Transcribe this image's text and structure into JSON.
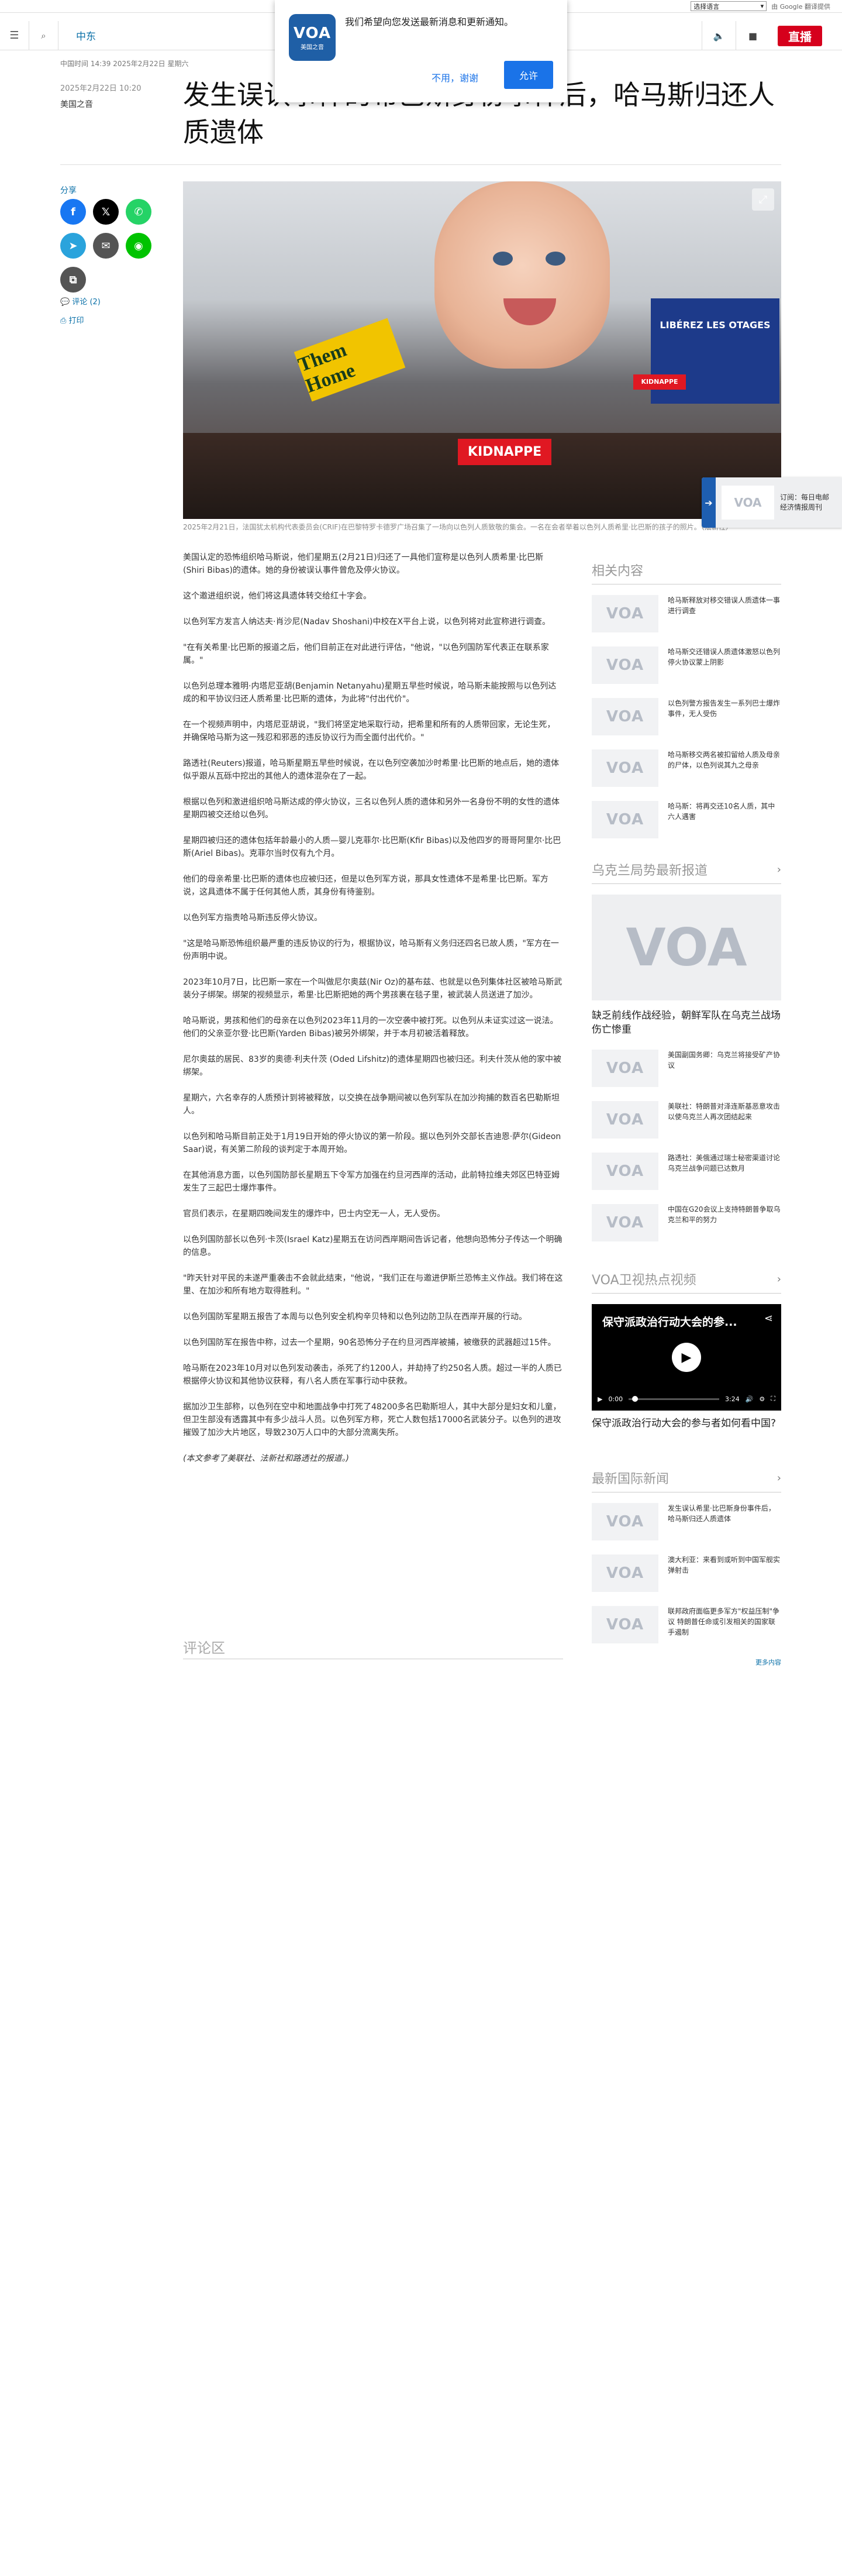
{
  "translate": {
    "select_label": "选择语言",
    "powered": "由 Google",
    "translate": "翻译提供"
  },
  "header": {
    "section": "中东",
    "live": "直播"
  },
  "notify": {
    "logo_main": "VOA",
    "logo_sub": "美国之音",
    "message": "我们希望向您发送最新消息和更新通知。",
    "decline": "不用，谢谢",
    "accept": "允许"
  },
  "article": {
    "dateline": "中国时间 14:39 2025年2月22日 星期六",
    "pubdate": "2025年2月22日 10:20",
    "byline": "美国之音",
    "headline": "发生误认事件的希巴斯身份事件后，哈马斯归还人质遗体",
    "caption": "2025年2月21日，法国犹太机构代表委员会(CRIF)在巴黎特罗卡德罗广场召集了一场向以色列人质致敬的集会。一名在会者举着以色列人质希里·比巴斯的孩子的照片。（法新社）",
    "paragraphs": [
      "美国认定的恐怖组织哈马斯说，他们星期五(2月21日)归还了一具他们宣称是以色列人质希里·比巴斯(Shiri Bibas)的遗体。她的身份被误认事件曾危及停火协议。",
      "这个邀进组织说，他们将这具遗体转交给红十字会。",
      "以色列军方发言人纳达夫·肖沙尼(Nadav Shoshani)中校在X平台上说，以色列将对此宣称进行调查。",
      "\"在有关希里·比巴斯的报道之后，他们目前正在对此进行评估，\"他说，\"以色列国防军代表正在联系家属。\"",
      "以色列总理本雅明·内塔尼亚胡(Benjamin Netanyahu)星期五早些时候说，哈马斯未能按照与以色列达成的和平协议归还人质希里·比巴斯的遗体，为此将\"付出代价\"。",
      "在一个视频声明中，内塔尼亚胡说，\"我们将坚定地采取行动，把希里和所有的人质带回家，无论生死，并确保哈马斯为这一残忍和邪恶的违反协议行为而全面付出代价。\"",
      "路透社(Reuters)报道，哈马斯星期五早些时候说，在以色列空袭加沙时希里·比巴斯的地点后，她的遗体似乎跟从瓦砾中挖出的其他人的遗体混杂在了一起。",
      "根据以色列和激进组织哈马斯达成的停火协议，三名以色列人质的遗体和另外一名身份不明的女性的遗体星期四被交还给以色列。",
      "星期四被归还的遗体包括年龄最小的人质—婴儿克菲尔·比巴斯(Kfir Bibas)以及他四岁的哥哥阿里尔·比巴斯(Ariel Bibas)。克菲尔当时仅有九个月。",
      "他们的母亲希里·比巴斯的遗体也应被归还，但是以色列军方说，那具女性遗体不是希里·比巴斯。军方说，这具遗体不属于任何其他人质，其身份有待鉴别。",
      "以色列军方指责哈马斯违反停火协议。",
      "\"这是哈马斯恐怖组织最严重的违反协议的行为，根据协议，哈马斯有义务归还四名已故人质，\"军方在一份声明中说。",
      "2023年10月7日，比巴斯一家在一个叫做尼尔奥兹(Nir Oz)的基布兹、也就是以色列集体社区被哈马斯武装分子绑架。绑架的视频显示，希里·比巴斯把她的两个男孩裹在毯子里，被武装人员送进了加沙。",
      "哈马斯说，男孩和他们的母亲在以色列2023年11月的一次空袭中被打死。以色列从未证实过这一说法。他们的父亲亚尔登·比巴斯(Yarden Bibas)被另外绑架，并于本月初被活着释放。",
      "尼尔奥兹的居民、83岁的奥德·利夫什茨 (Oded Lifshitz)的遗体星期四也被归还。利夫什茨从他的家中被绑架。",
      "星期六，六名幸存的人质预计到将被释放，以交换在战争期间被以色列军队在加沙拘捕的数百名巴勒斯坦人。",
      "以色列和哈马斯目前正处于1月19日开始的停火协议的第一阶段。据以色列外交部长吉迪恩·萨尔(Gideon Saar)说，有关第二阶段的谈判定于本周开始。",
      "在其他消息方面，以色列国防部长星期五下令军方加强在约旦河西岸的活动，此前特拉维夫郊区巴特亚姆发生了三起巴士爆炸事件。",
      "官员们表示，在星期四晚间发生的爆炸中，巴士内空无一人，无人受伤。",
      "以色列国防部长以色列·卡茨(Israel Katz)星期五在访问西岸期间告诉记者，他想向恐怖分子传达一个明确的信息。",
      "\"昨天针对平民的未遂严重袭击不会就此结束，\"他说，\"我们正在与邀进伊斯兰恐怖主义作战。我们将在这里、在加沙和所有地方取得胜利。\"",
      "以色列国防军星期五报告了本周与以色列安全机构辛贝特和以色列边防卫队在西岸开展的行动。",
      "以色列国防军在报告中称，过去一个星期，90名恐怖分子在约旦河西岸被捕，被缴获的武器超过15件。",
      "哈马斯在2023年10月对以色列发动袭击，杀死了约1200人，并劫持了约250名人质。超过一半的人质已根据停火协议和其他协议获释，有八名人质在军事行动中获救。",
      "据加沙卫生部称，以色列在空中和地面战争中打死了48200多名巴勒斯坦人，其中大部分是妇女和儿童，但卫生部没有透露其中有多少战斗人员。以色列军方称，死亡人数包括17000名武装分子。以色列的进攻摧毁了加沙大片地区，导致230万人口中的大部分流离失所。"
    ],
    "note": "(本文参考了美联社、法新社和路透社的报道。)",
    "comments_title": "评论区"
  },
  "share": {
    "label": "分享",
    "comments": "评论 (2)",
    "print": "打印",
    "buttons": [
      {
        "name": "facebook",
        "glyph": "f",
        "color": "#1877f2"
      },
      {
        "name": "x",
        "glyph": "𝕏",
        "color": "#000000"
      },
      {
        "name": "whatsapp",
        "glyph": "✆",
        "color": "#25d366"
      },
      {
        "name": "telegram",
        "glyph": "➤",
        "color": "#2aa3dc"
      },
      {
        "name": "email",
        "glyph": "✉",
        "color": "#545454"
      },
      {
        "name": "line",
        "glyph": "◉",
        "color": "#00c300"
      },
      {
        "name": "copy-link",
        "glyph": "⧉",
        "color": "#545454"
      }
    ]
  },
  "hero": {
    "sign_left": "Them Home",
    "sign_right": "LIBÉREZ LES OTAGES",
    "sign_red": "KIDNAPPE",
    "sign_red2": "KIDNAPPE"
  },
  "sidebar": {
    "related_heading": "相关内容",
    "related": [
      "哈马斯释放对移交错误人质遗体一事进行调查",
      "哈马斯交还错误人质遗体激怒以色列 停火协议蒙上阴影",
      "以色列警方报告发生一系列巴士爆炸事件，无人受伤",
      "哈马斯移交两名被扣留给人质及母亲的尸体，以色列说其九之母亲",
      "哈马斯：将再交还10名人质，其中六人遇害"
    ],
    "ukraine_heading": "乌克兰局势最新报道",
    "ukraine_feature": "缺乏前线作战经验，朝鲜军队在乌克兰战场伤亡惨重",
    "ukraine": [
      "美国副国务卿：乌克兰将接受矿产协议",
      "美联社：特朗普对泽连斯基恶意攻击以使乌克兰人再次团结起来",
      "路透社：美俄通过瑞士秘密渠道讨论乌克兰战争问题已达数月",
      "中国在G20会议上支持特朗普争取乌克兰和平的努力"
    ],
    "video_heading": "VOA卫视热点视频",
    "video_title": "保守派政治行动大会的参...",
    "video_time_current": "0:00",
    "video_time_total": "3:24",
    "video_caption": "保守派政治行动大会的参与者如何看中国?",
    "latest_heading": "最新国际新闻",
    "latest": [
      "发生误认希里·比巴斯身份事件后，哈马斯归还人质遗体",
      "澳大利亚：来看到或听到中国军舰实弹射击",
      "联邦政府面临更多军方\"权益压制\"争议 特朗普任命或引发相关的国家联手遏制"
    ],
    "more": "更多内容"
  },
  "listen": {
    "text_1": "订阅：每日电邮",
    "text_2": "经济情报周刊"
  }
}
